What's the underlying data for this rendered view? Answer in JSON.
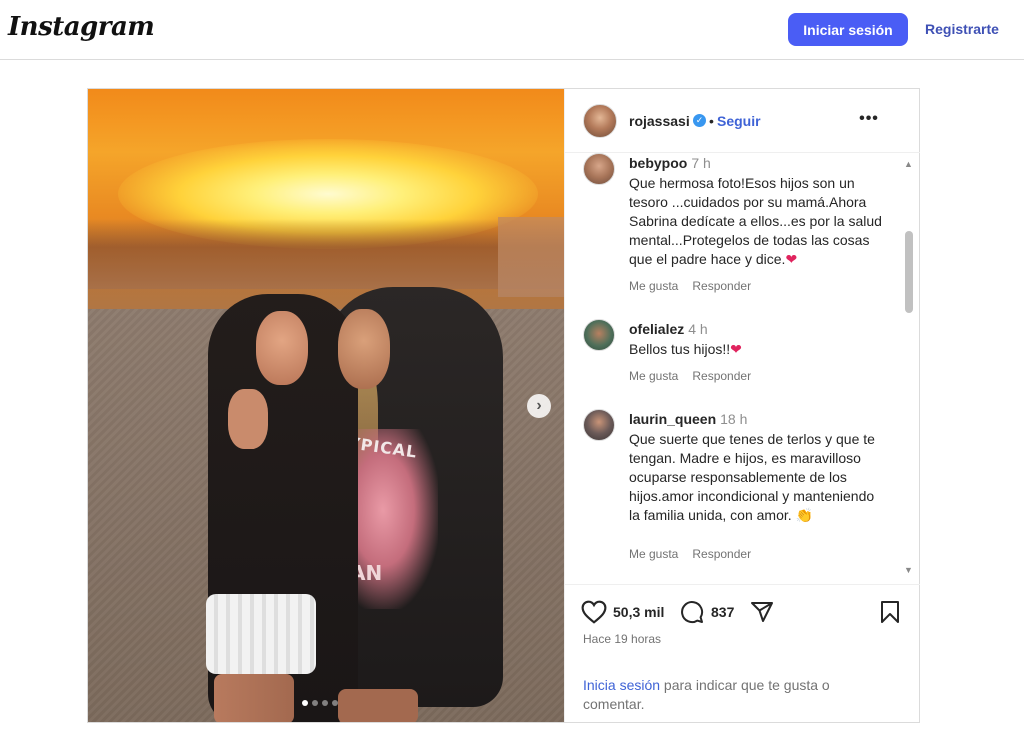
{
  "header": {
    "logo": "Instagram",
    "login_button": "Iniciar sesión",
    "register_link": "Registrarte"
  },
  "post": {
    "author": "rojassasi",
    "follow": "Seguir",
    "separator": "•",
    "verified_icon": "verified-badge-icon",
    "comments": [
      {
        "user": "bebypoo",
        "time": "7 h",
        "text": "Que hermosa foto!Esos hijos son un tesoro ...cuidados por su mamá.Ahora Sabrina dedícate a ellos...es por la salud mental...Protegelos de todas las cosas que el padre hace y dice.",
        "emoji": "❤",
        "like": "Me gusta",
        "reply": "Responder"
      },
      {
        "user": "ofelialez",
        "time": "4 h",
        "text": "Bellos tus hijos!!",
        "emoji": "❤",
        "like": "Me gusta",
        "reply": "Responder"
      },
      {
        "user": "laurin_queen",
        "time": "18 h",
        "text": "Que suerte que tenes de terlos y que te tengan. Madre e hijos, es maravilloso ocuparse responsablemente de los hijos.amor incondicional y manteniendo la familia unida, con amor.",
        "emoji": "👏",
        "like": "Me gusta",
        "reply": "Responder"
      }
    ],
    "likes": "50,3 mil",
    "comment_count": "837",
    "time_ago": "Hace 19 horas",
    "login_prompt_link": "Inicia sesión",
    "login_prompt_rest": " para indicar que te gusta o comentar."
  },
  "photo": {
    "shirt_text_top": "TYPICAL",
    "shirt_text_bottom": "AN",
    "carousel_current": 1,
    "carousel_total": 4
  },
  "icons": {
    "heart": "heart-icon",
    "comment": "comment-bubble-icon",
    "share": "paper-plane-icon",
    "save": "bookmark-icon",
    "more": "more-options-icon",
    "next": "chevron-right-icon"
  },
  "colors": {
    "accent": "#4a5df5",
    "link": "#3f63d6"
  }
}
